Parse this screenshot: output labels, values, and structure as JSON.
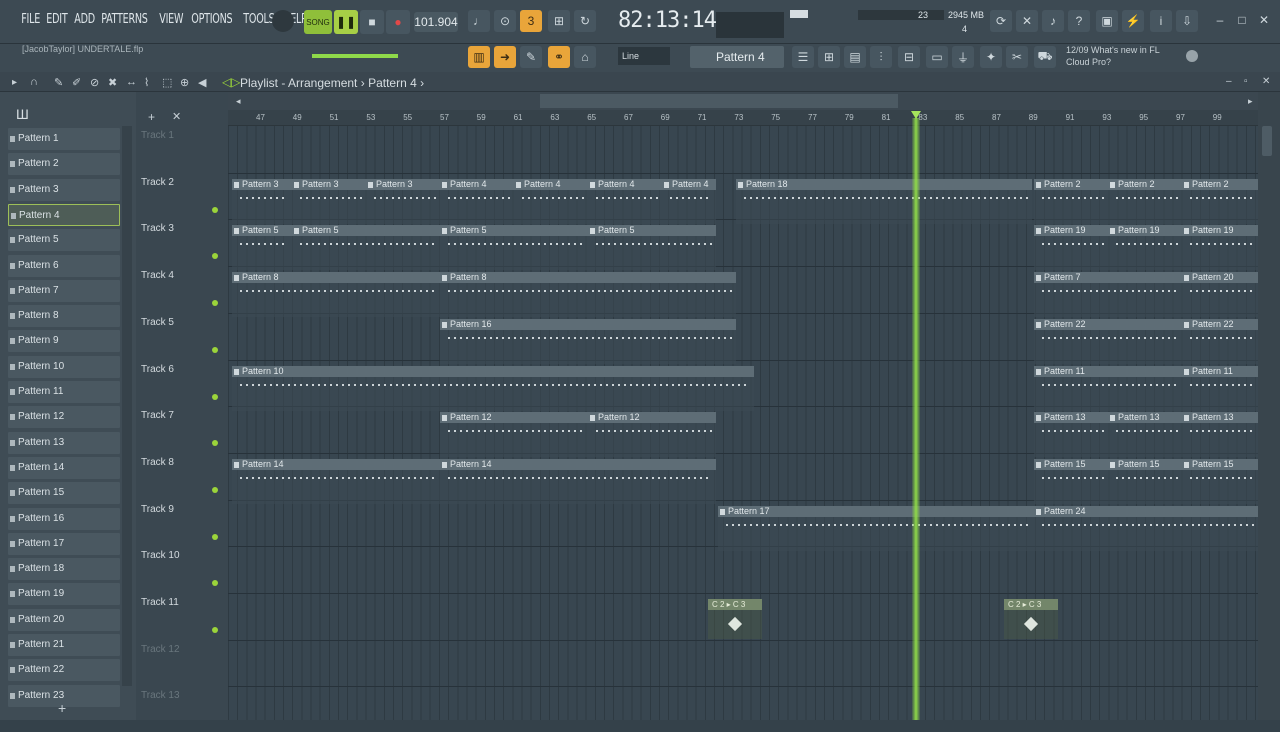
{
  "menu": [
    "FILE",
    "EDIT",
    "ADD",
    "PATTERNS",
    "VIEW",
    "OPTIONS",
    "TOOLS",
    "HELP"
  ],
  "transport": {
    "mode": "SONG",
    "tempo": "101.904",
    "time": "82:13:14",
    "time_sub": "B:S:T",
    "cpu_label": "23",
    "ram": "2945 MB",
    "poly": "4"
  },
  "hint": "[JacobTaylor] UNDERTALE.flp",
  "toolbar": {
    "snap": "Line",
    "current_pattern": "Pattern 4"
  },
  "news": {
    "date": "12/09",
    "text": "What's new in FL Cloud Pro?"
  },
  "playlist": {
    "title": "Playlist - Arrangement",
    "breadcrumb": "Pattern 4"
  },
  "patterns": [
    "Pattern 1",
    "Pattern 2",
    "Pattern 3",
    "Pattern 4",
    "Pattern 5",
    "Pattern 6",
    "Pattern 7",
    "Pattern 8",
    "Pattern 9",
    "Pattern 10",
    "Pattern 11",
    "Pattern 12",
    "Pattern 13",
    "Pattern 14",
    "Pattern 15",
    "Pattern 16",
    "Pattern 17",
    "Pattern 18",
    "Pattern 19",
    "Pattern 20",
    "Pattern 21",
    "Pattern 22",
    "Pattern 23"
  ],
  "selected_pattern": "Pattern 4",
  "tracks": [
    "Track 1",
    "Track 2",
    "Track 3",
    "Track 4",
    "Track 5",
    "Track 6",
    "Track 7",
    "Track 8",
    "Track 9",
    "Track 10",
    "Track 11",
    "Track 12",
    "Track 13"
  ],
  "ruler": [
    "47",
    "49",
    "51",
    "53",
    "55",
    "57",
    "59",
    "61",
    "63",
    "65",
    "67",
    "69",
    "71",
    "73",
    "75",
    "77",
    "79",
    "81",
    "83",
    "85",
    "87",
    "89",
    "91",
    "93",
    "95",
    "97",
    "99"
  ],
  "clips": {
    "track2": [
      "Pattern 3",
      "Pattern 3",
      "Pattern 3",
      "Pattern 4",
      "Pattern 4",
      "Pattern 4",
      "Pattern 4",
      "Pattern 18",
      "Pattern 2",
      "Pattern 2",
      "Pattern 2"
    ],
    "track3": [
      "Pattern 5",
      "Pattern 5",
      "Pattern 5",
      "Pattern 5",
      "Pattern 19",
      "Pattern 19",
      "Pattern 19"
    ],
    "track4": [
      "Pattern 8",
      "Pattern 8",
      "Pattern 7",
      "Pattern 20"
    ],
    "track5": [
      "Pattern 16",
      "Pattern 22",
      "Pattern 22"
    ],
    "track6": [
      "Pattern 10",
      "Pattern 11",
      "Pattern 11"
    ],
    "track7": [
      "Pattern 12",
      "Pattern 12",
      "Pattern 13",
      "Pattern 13",
      "Pattern 13"
    ],
    "track8": [
      "Pattern 14",
      "Pattern 14",
      "Pattern 15",
      "Pattern 15",
      "Pattern 15"
    ],
    "track9": [
      "Pattern 17",
      "Pattern 24"
    ],
    "track11": [
      "C 2 ▸ C 3",
      "C 2 ▸ C 3"
    ]
  },
  "colors": {
    "accent": "#e9a53a",
    "playhead": "#8fd94a",
    "clip_header": "#5e6d76"
  }
}
